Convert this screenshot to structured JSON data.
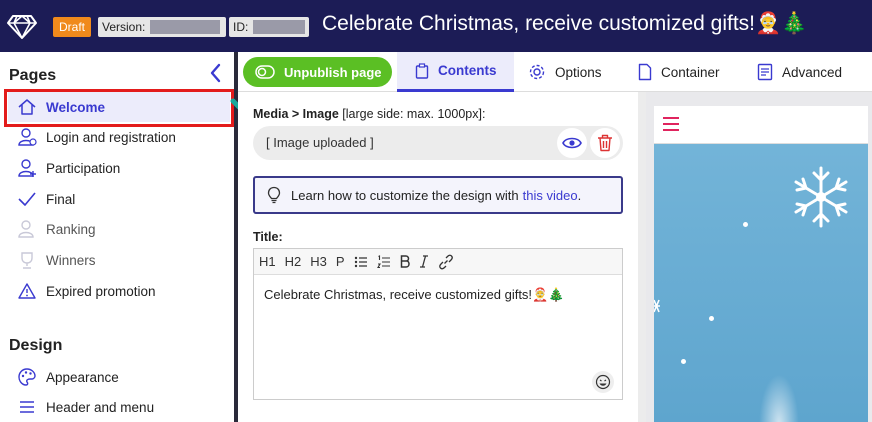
{
  "header": {
    "status_badge": "Draft",
    "version_label": "Version:",
    "id_label": "ID:",
    "page_title": "Celebrate Christmas, receive customized gifts!🤶🎄"
  },
  "sidebar": {
    "pages_title": "Pages",
    "pages": [
      {
        "label": "Welcome",
        "icon": "home-icon",
        "active": true
      },
      {
        "label": "Login and registration",
        "icon": "user-check-icon"
      },
      {
        "label": "Participation",
        "icon": "user-add-icon"
      },
      {
        "label": "Final",
        "icon": "checkmark-icon"
      },
      {
        "label": "Ranking",
        "icon": "user-rank-icon",
        "disabled": true
      },
      {
        "label": "Winners",
        "icon": "trophy-icon",
        "disabled": true
      },
      {
        "label": "Expired promotion",
        "icon": "warning-icon"
      }
    ],
    "design_title": "Design",
    "design": [
      {
        "label": "Appearance",
        "icon": "palette-icon"
      },
      {
        "label": "Header and menu",
        "icon": "menu-icon"
      }
    ]
  },
  "toolbar": {
    "unpublish_label": "Unpublish page",
    "tabs": [
      {
        "label": "Contents",
        "icon": "clipboard-icon",
        "active": true
      },
      {
        "label": "Options",
        "icon": "gear-icon"
      },
      {
        "label": "Container",
        "icon": "file-icon"
      },
      {
        "label": "Advanced",
        "icon": "document-list-icon"
      }
    ]
  },
  "editor": {
    "media_label_bold": "Media > Image",
    "media_label_hint": "[large side: max. 1000px]:",
    "image_value": "[ Image uploaded ]",
    "info_text": "Learn how to customize the design with",
    "info_link": "this video",
    "info_suffix": ".",
    "title_label": "Title:",
    "rte_tools": [
      "H1",
      "H2",
      "H3",
      "P"
    ],
    "title_value": "Celebrate Christmas, receive customized gifts!🤶🎄"
  },
  "colors": {
    "header_bg": "#1c1c56",
    "accent": "#3a3ad0",
    "draft_badge": "#f08a1c",
    "unpublish_green": "#5bbf24",
    "highlight_red": "#e31b1b"
  }
}
